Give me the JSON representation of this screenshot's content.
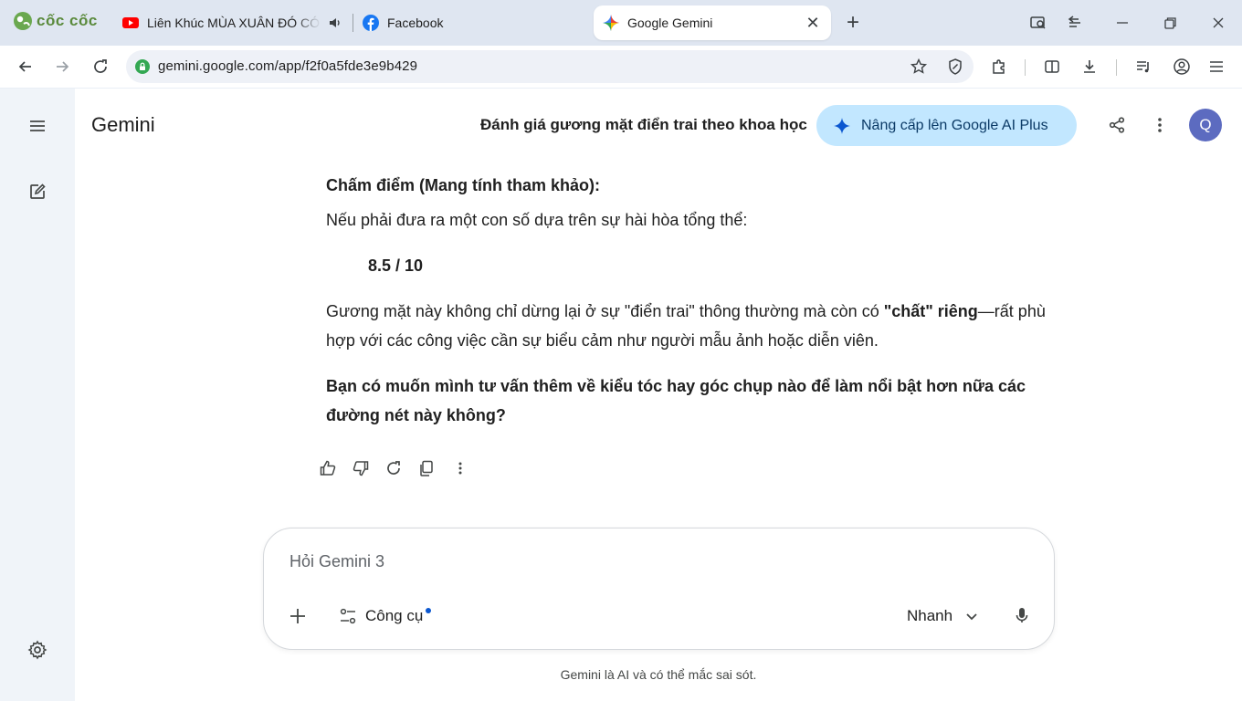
{
  "browser": {
    "brand": "cốc cốc",
    "tabs": [
      {
        "title": "Liên Khúc MÙA XUÂN ĐÓ CÓ EM",
        "icon": "youtube-icon",
        "audio": true
      },
      {
        "title": "Facebook",
        "icon": "facebook-icon"
      },
      {
        "title": "Google Gemini",
        "icon": "gemini-icon",
        "active": true
      }
    ],
    "url": "gemini.google.com/app/f2f0a5fde3e9b429"
  },
  "gemini": {
    "logo": "Gemini",
    "conversation_title": "Đánh giá gương mặt điển trai theo khoa học",
    "upgrade_label": "Nâng cấp lên Google AI Plus",
    "avatar_initial": "Q"
  },
  "response": {
    "heading": "Chấm điểm (Mang tính tham khảo):",
    "intro": "Nếu phải đưa ra một con số dựa trên sự hài hòa tổng thể:",
    "score": "8.5 / 10",
    "para_before": "Gương mặt này không chỉ dừng lại ở sự \"điển trai\" thông thường mà còn có ",
    "para_bold": "\"chất\" riêng",
    "para_after": "—rất phù hợp với các công việc cần sự biểu cảm như người mẫu ảnh hoặc diễn viên.",
    "question": "Bạn có muốn mình tư vấn thêm về kiểu tóc hay góc chụp nào để làm nổi bật hơn nữa các đường nét này không?"
  },
  "composer": {
    "placeholder": "Hỏi Gemini 3",
    "tools_label": "Công cụ",
    "mode_label": "Nhanh"
  },
  "disclaimer": "Gemini là AI và có thể mắc sai sót.",
  "colors": {
    "upgrade_bg": "#c2e7ff",
    "avatar_bg": "#5c6bc0",
    "rail_bg": "#f0f4f9",
    "tab_strip_bg": "#dfe6f1",
    "tools_dot": "#0b57d0"
  }
}
